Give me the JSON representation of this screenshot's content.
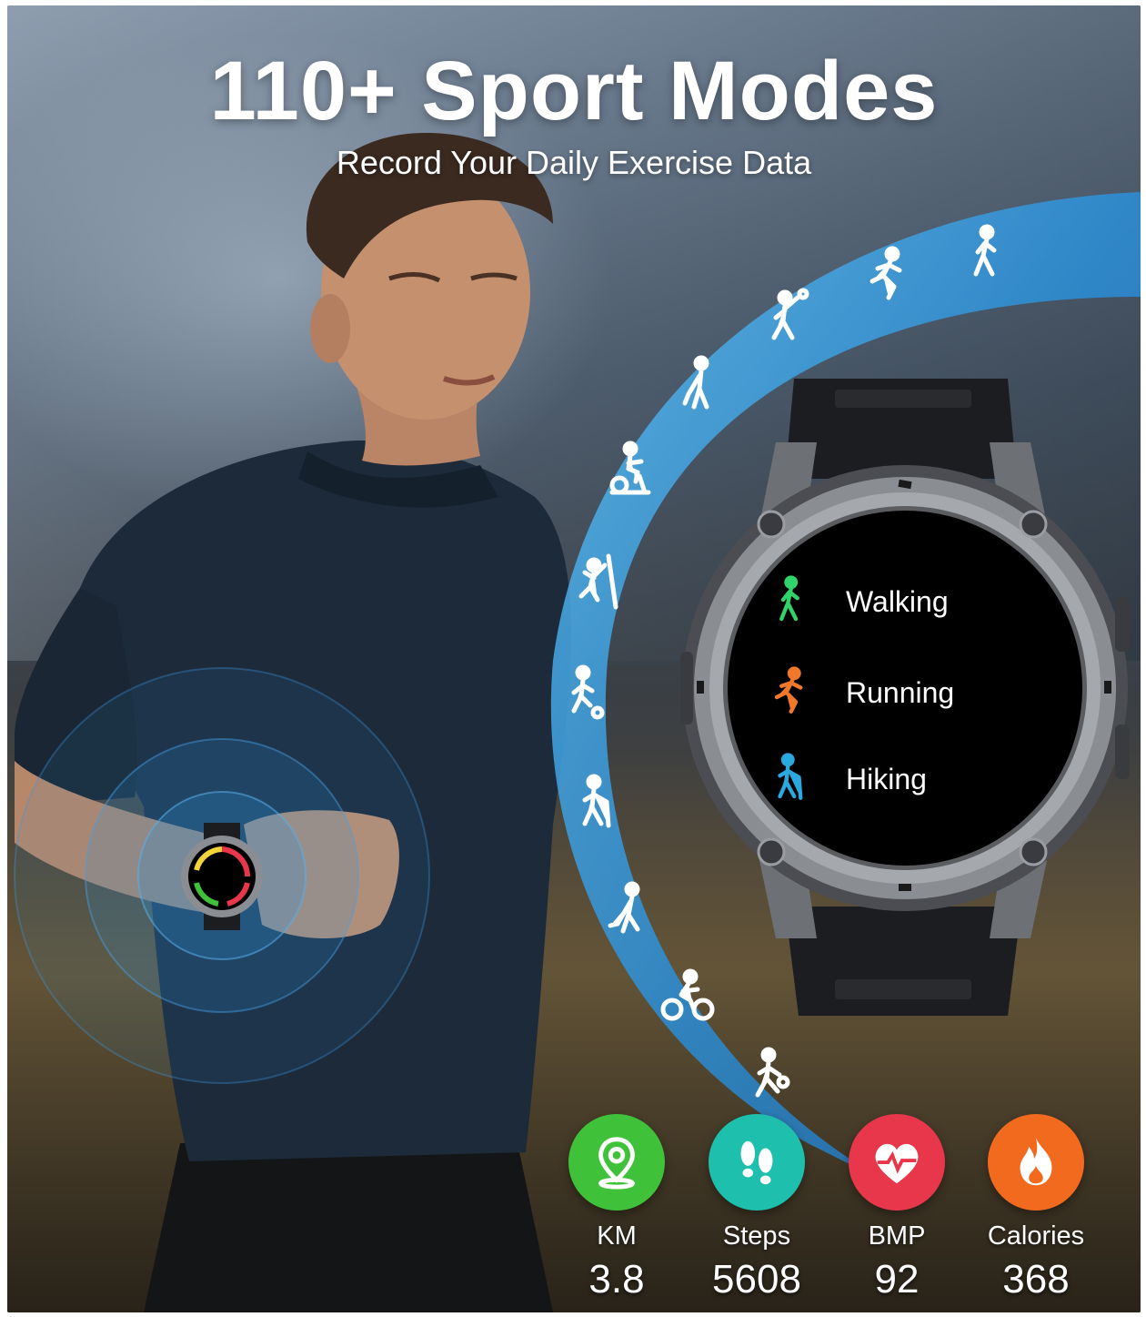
{
  "header": {
    "title": "110+ Sport Modes",
    "subtitle": "Record Your Daily Exercise Data"
  },
  "sport_icons": [
    "walking-icon",
    "running-icon",
    "badminton-icon",
    "golf-icon",
    "spin-bike-icon",
    "climbing-icon",
    "football-icon",
    "hiking-icon",
    "hockey-icon",
    "cycling-icon",
    "basketball-icon"
  ],
  "watch": {
    "modes": [
      {
        "label": "Walking",
        "color": "#2fd46a",
        "icon": "walking-icon"
      },
      {
        "label": "Running",
        "color": "#f0782a",
        "icon": "running-icon"
      },
      {
        "label": "Hiking",
        "color": "#2aa8e0",
        "icon": "hiking-icon"
      }
    ],
    "bezel_color": "#8a8d92",
    "strap_color": "#1c1d20"
  },
  "stats": [
    {
      "label": "KM",
      "value": "3.8",
      "icon": "location-pin-icon",
      "color": "#3fc23a"
    },
    {
      "label": "Steps",
      "value": "5608",
      "icon": "footprints-icon",
      "color": "#1fbfae"
    },
    {
      "label": "BMP",
      "value": "92",
      "icon": "heart-rate-icon",
      "color": "#e8364a"
    },
    {
      "label": "Calories",
      "value": "368",
      "icon": "flame-icon",
      "color": "#f26a1e"
    }
  ],
  "colors": {
    "arc_blue": "#2b8fd8",
    "arc_light": "#58b9f0"
  }
}
